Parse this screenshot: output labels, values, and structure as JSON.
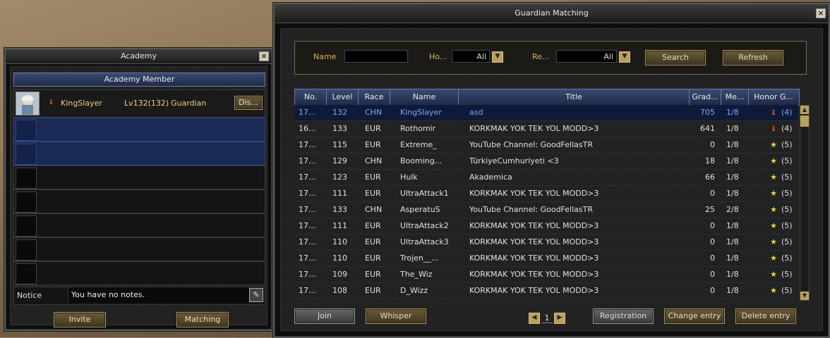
{
  "academy": {
    "title": "Academy",
    "header": "Academy Member",
    "member": {
      "name": "KingSlayer",
      "level": "Lv132(132)",
      "role": "Guardian",
      "dismiss_label": "Dis..."
    },
    "notice_label": "Notice",
    "notice_text": "You have no notes.",
    "invite_label": "Invite",
    "matching_label": "Matching"
  },
  "guardian": {
    "title": "Guardian Matching",
    "filters": {
      "name_label": "Name",
      "name_value": "",
      "honor_label": "Ho...",
      "honor_value": "All",
      "race_label": "Re...",
      "race_value": "All",
      "search_label": "Search",
      "refresh_label": "Refresh"
    },
    "columns": [
      "No.",
      "Level",
      "Race",
      "Name",
      "Title",
      "Grad...",
      "Me...",
      "Honor G..."
    ],
    "rows": [
      {
        "no": "17...",
        "level": "132",
        "race": "CHN",
        "name": "KingSlayer",
        "title": "asd",
        "grade": "705",
        "members": "1/8",
        "honor": "(4)",
        "icon": "rank-icon"
      },
      {
        "no": "16...",
        "level": "133",
        "race": "EUR",
        "name": "Rothomir",
        "title": "KORKMAK YOK TEK YOL MODD>3",
        "grade": "641",
        "members": "1/8",
        "honor": "(4)",
        "icon": "rank-icon"
      },
      {
        "no": "17...",
        "level": "115",
        "race": "EUR",
        "name": "Extreme_",
        "title": "YouTube Channel: GoodFellasTR",
        "grade": "0",
        "members": "1/8",
        "honor": "(5)",
        "icon": "star-icon"
      },
      {
        "no": "17...",
        "level": "129",
        "race": "CHN",
        "name": "Booming...",
        "title": "TürkiyeCumhuriyeti <3",
        "grade": "18",
        "members": "1/8",
        "honor": "(5)",
        "icon": "star-icon"
      },
      {
        "no": "17...",
        "level": "123",
        "race": "EUR",
        "name": "Hulk",
        "title": "Akademica",
        "grade": "66",
        "members": "1/8",
        "honor": "(5)",
        "icon": "star-icon"
      },
      {
        "no": "17...",
        "level": "111",
        "race": "EUR",
        "name": "UltraAttack1",
        "title": "KORKMAK YOK TEK YOL MODD>3",
        "grade": "0",
        "members": "1/8",
        "honor": "(5)",
        "icon": "star-icon"
      },
      {
        "no": "17...",
        "level": "133",
        "race": "CHN",
        "name": "AsperatuS",
        "title": "YouTube Channel: GoodFellasTR",
        "grade": "25",
        "members": "2/8",
        "honor": "(5)",
        "icon": "star-icon"
      },
      {
        "no": "17...",
        "level": "111",
        "race": "EUR",
        "name": "UltraAttack2",
        "title": "KORKMAK YOK TEK YOL MODD>3",
        "grade": "0",
        "members": "1/8",
        "honor": "(5)",
        "icon": "star-icon"
      },
      {
        "no": "17...",
        "level": "110",
        "race": "EUR",
        "name": "UltraAttack3",
        "title": "KORKMAK YOK TEK YOL MODD>3",
        "grade": "0",
        "members": "1/8",
        "honor": "(5)",
        "icon": "star-icon"
      },
      {
        "no": "17...",
        "level": "110",
        "race": "EUR",
        "name": "Trojen__...",
        "title": "KORKMAK YOK TEK YOL MODD>3",
        "grade": "0",
        "members": "1/8",
        "honor": "(5)",
        "icon": "star-icon"
      },
      {
        "no": "17...",
        "level": "109",
        "race": "EUR",
        "name": "The_Wiz",
        "title": "KORKMAK YOK TEK YOL MODD>3",
        "grade": "0",
        "members": "1/8",
        "honor": "(5)",
        "icon": "star-icon"
      },
      {
        "no": "17...",
        "level": "108",
        "race": "EUR",
        "name": "D_Wizz",
        "title": "KORKMAK YOK TEK YOL MODD>3",
        "grade": "0",
        "members": "1/8",
        "honor": "(5)",
        "icon": "star-icon"
      }
    ],
    "join_label": "Join",
    "whisper_label": "Whisper",
    "page": "1",
    "registration_label": "Registration",
    "change_entry_label": "Change entry",
    "delete_entry_label": "Delete entry"
  }
}
